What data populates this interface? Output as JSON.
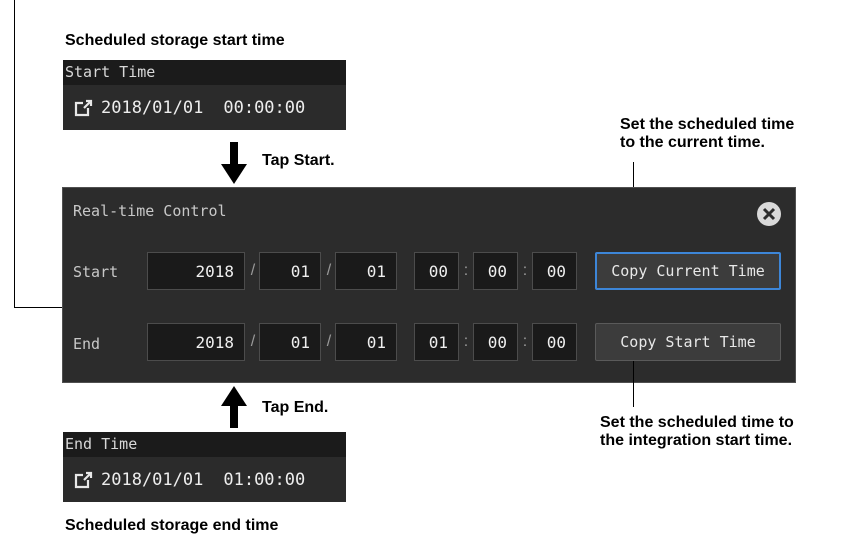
{
  "captions": {
    "scheduled_start": "Scheduled storage start time",
    "scheduled_end": "Scheduled storage end time",
    "tap_start": "Tap Start.",
    "tap_end": "Tap End.",
    "current_time_note_1": "Set the scheduled time",
    "current_time_note_2": "to the current time.",
    "start_time_note_1": "Set the scheduled time to",
    "start_time_note_2": "the integration start time."
  },
  "start_box": {
    "title": "Start Time",
    "date": "2018/01/01",
    "time": "00:00:00",
    "icon": "external-link-icon"
  },
  "end_box": {
    "title": "End Time",
    "date": "2018/01/01",
    "time": "01:00:00",
    "icon": "external-link-icon"
  },
  "panel": {
    "title": "Real-time Control",
    "close_icon": "close-circle-icon",
    "date_separator": "/",
    "time_separator": ":",
    "start": {
      "label": "Start",
      "year": "2018",
      "month": "01",
      "day": "01",
      "hour": "00",
      "minute": "00",
      "second": "00"
    },
    "end": {
      "label": "End",
      "year": "2018",
      "month": "01",
      "day": "01",
      "hour": "01",
      "minute": "00",
      "second": "00"
    },
    "copy_current_time": "Copy Current Time",
    "copy_start_time": "Copy Start Time"
  },
  "colors": {
    "panel_bg": "#2c2c2c",
    "field_bg": "#1a1a1a",
    "active_border": "#3d86d8"
  }
}
